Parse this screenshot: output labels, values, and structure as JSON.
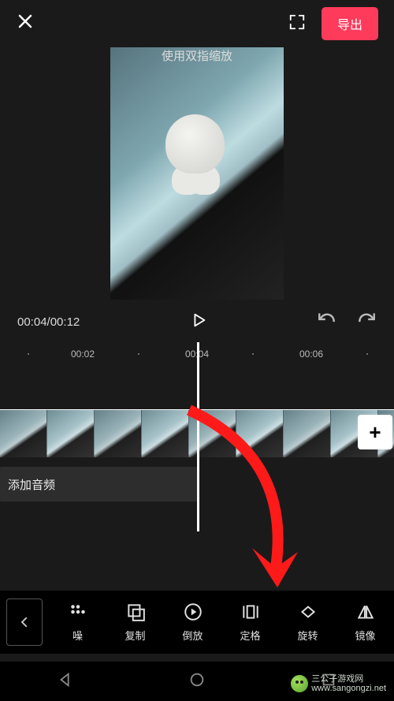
{
  "header": {
    "hint": "使用双指缩放",
    "export_label": "导出"
  },
  "playback": {
    "current_time": "00:04",
    "total_time": "00:12"
  },
  "timeline": {
    "marks": [
      "00:02",
      "00:04",
      "00:06"
    ],
    "audio_label": "添加音频"
  },
  "toolbar": {
    "items": [
      {
        "id": "denoise",
        "label": "噪"
      },
      {
        "id": "copy",
        "label": "复制"
      },
      {
        "id": "reverse",
        "label": "倒放"
      },
      {
        "id": "freeze",
        "label": "定格"
      },
      {
        "id": "rotate",
        "label": "旋转"
      },
      {
        "id": "mirror",
        "label": "镜像"
      }
    ]
  },
  "watermark": {
    "line1": "三公子游戏网",
    "line2": "www.sangongzi.net"
  }
}
